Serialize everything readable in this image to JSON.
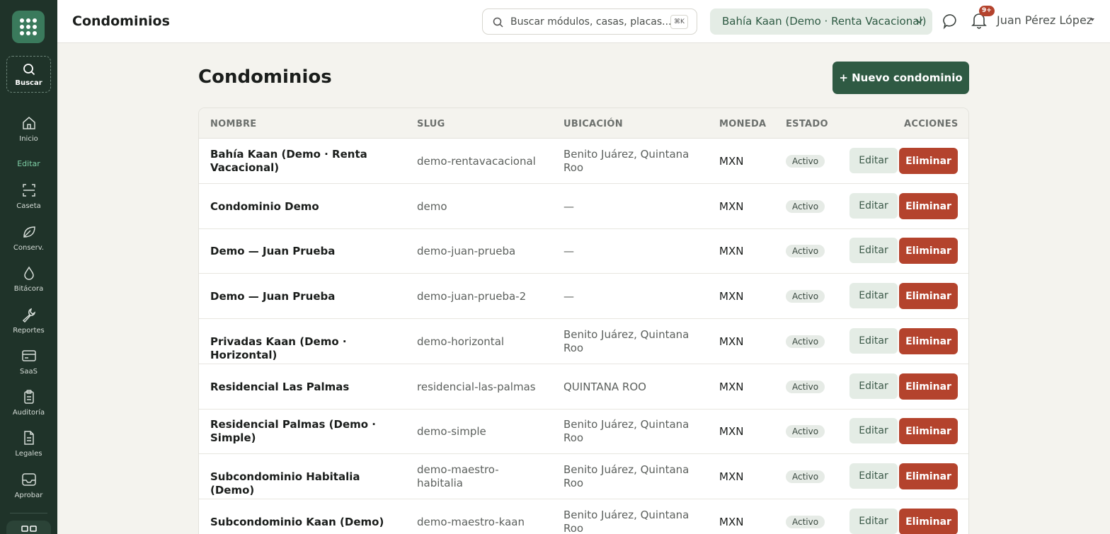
{
  "sidebar": {
    "search_label": "Buscar",
    "section_label": "Editar",
    "items": [
      {
        "label": "Inicio",
        "icon": "home-icon"
      },
      {
        "label": "Caseta",
        "icon": "scan-icon"
      },
      {
        "label": "Conserv.",
        "icon": "leaf-icon"
      },
      {
        "label": "Bitácora",
        "icon": "drop-icon"
      },
      {
        "label": "Reportes",
        "icon": "wrench-icon"
      },
      {
        "label": "SaaS",
        "icon": "card-icon"
      },
      {
        "label": "Auditoría",
        "icon": "clipboard-icon"
      },
      {
        "label": "Legales",
        "icon": "document-icon"
      },
      {
        "label": "Aprobar",
        "icon": "inbox-icon"
      }
    ]
  },
  "header": {
    "title": "Condominios",
    "search_placeholder": "Buscar módulos, casas, placas...",
    "search_shortcut": "⌘K",
    "condo_selected": "Bahía Kaan (Demo · Renta Vacacional)",
    "notification_count": "9+",
    "user_name": "Juan Pérez López"
  },
  "main": {
    "title": "Condominios",
    "new_button": "+ Nuevo condominio",
    "columns": [
      "NOMBRE",
      "SLUG",
      "UBICACIÓN",
      "MONEDA",
      "ESTADO",
      "ACCIONES"
    ],
    "edit_label": "Editar",
    "delete_label": "Eliminar",
    "rows": [
      {
        "name": "Bahía Kaan (Demo · Renta Vacacional)",
        "slug": "demo-rentavacacional",
        "location": "Benito Juárez, Quintana Roo",
        "currency": "MXN",
        "status": "Activo"
      },
      {
        "name": "Condominio Demo",
        "slug": "demo",
        "location": "—",
        "currency": "MXN",
        "status": "Activo"
      },
      {
        "name": "Demo — Juan Prueba",
        "slug": "demo-juan-prueba",
        "location": "—",
        "currency": "MXN",
        "status": "Activo"
      },
      {
        "name": "Demo — Juan Prueba",
        "slug": "demo-juan-prueba-2",
        "location": "—",
        "currency": "MXN",
        "status": "Activo"
      },
      {
        "name": "Privadas Kaan (Demo · Horizontal)",
        "slug": "demo-horizontal",
        "location": "Benito Juárez, Quintana Roo",
        "currency": "MXN",
        "status": "Activo"
      },
      {
        "name": "Residencial Las Palmas",
        "slug": "residencial-las-palmas",
        "location": "QUINTANA ROO",
        "currency": "MXN",
        "status": "Activo"
      },
      {
        "name": "Residencial Palmas (Demo · Simple)",
        "slug": "demo-simple",
        "location": "Benito Juárez, Quintana Roo",
        "currency": "MXN",
        "status": "Activo"
      },
      {
        "name": "Subcondominio Habitalia (Demo)",
        "slug": "demo-maestro-habitalia",
        "location": "Benito Juárez, Quintana Roo",
        "currency": "MXN",
        "status": "Activo"
      },
      {
        "name": "Subcondominio Kaan (Demo)",
        "slug": "demo-maestro-kaan",
        "location": "Benito Juárez, Quintana Roo",
        "currency": "MXN",
        "status": "Activo"
      }
    ]
  },
  "colors": {
    "sidebar_bg": "#1f3329",
    "brand_green": "#2f5a43",
    "danger": "#b4432d",
    "page_bg": "#f4f3ee"
  }
}
